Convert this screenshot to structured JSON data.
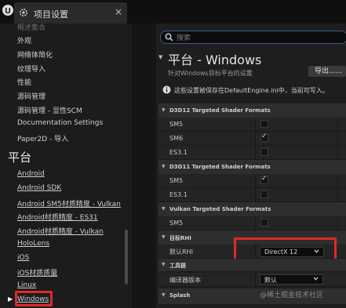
{
  "window": {
    "tab_title": "项目设置",
    "close_glyph": "×"
  },
  "sidebar": {
    "items": [
      {
        "label": "概述集合",
        "style": "faded"
      },
      {
        "label": "外观",
        "style": "plain"
      },
      {
        "label": "网络体简化",
        "style": "plain"
      },
      {
        "label": "纹理导入",
        "style": "plain"
      },
      {
        "label": "性能",
        "style": "plain"
      },
      {
        "label": "源码管理",
        "style": "plain"
      },
      {
        "label": "源码管理 - 显性SCM",
        "style": "plain"
      },
      {
        "label": "Documentation Settings",
        "style": "plain"
      },
      {
        "label": "Paper2D - 导入",
        "style": "plain"
      }
    ],
    "section_title": "平台",
    "platform_items": [
      {
        "label": "Android"
      },
      {
        "label": "Android SDK"
      },
      {
        "label": "Android SM5材质精度 - Vulkan"
      },
      {
        "label": "Android材质精度 - ES31"
      },
      {
        "label": "Android材质精度 - Vulkan"
      },
      {
        "label": "HoloLens"
      },
      {
        "label": "iOS"
      },
      {
        "label": "iOS材质质量"
      },
      {
        "label": "Linux"
      },
      {
        "label": "Windows"
      }
    ],
    "selected_item": "Windows"
  },
  "search": {
    "placeholder": "搜索"
  },
  "panel": {
    "title": "平台 - Windows",
    "subtitle": "针对Windows目标平台的设置",
    "export_label": "导出......",
    "info_text": "这些设置被保存在DefaultEngine.ini中，当前可写入。"
  },
  "sections": {
    "d3d12": {
      "title": "D3D12 Targeted Shader Formats",
      "props": [
        {
          "label": "SM5",
          "checked": false
        },
        {
          "label": "SM6",
          "checked": true
        },
        {
          "label": "ES3.1",
          "checked": false
        }
      ]
    },
    "d3d11": {
      "title": "D3D11 Targeted Shader Formats",
      "props": [
        {
          "label": "SM5",
          "checked": true
        },
        {
          "label": "ES3.1",
          "checked": false
        }
      ]
    },
    "vulkan": {
      "title": "Vulkan Targeted Shader Formats",
      "props": [
        {
          "label": "SM5",
          "checked": false
        }
      ]
    },
    "rhi": {
      "title": "目标RHI",
      "default_rhi_label": "默认RHI",
      "default_rhi_value": "DirectX 12"
    },
    "toolchain": {
      "title": "工具链",
      "compiler_label": "编译器版本",
      "compiler_value": "默认"
    },
    "splash": {
      "title": "Splash"
    }
  },
  "watermark": "@稀土掘金技术社区",
  "colors": {
    "highlight": "#e02828",
    "search_border": "#3a5f8a"
  }
}
